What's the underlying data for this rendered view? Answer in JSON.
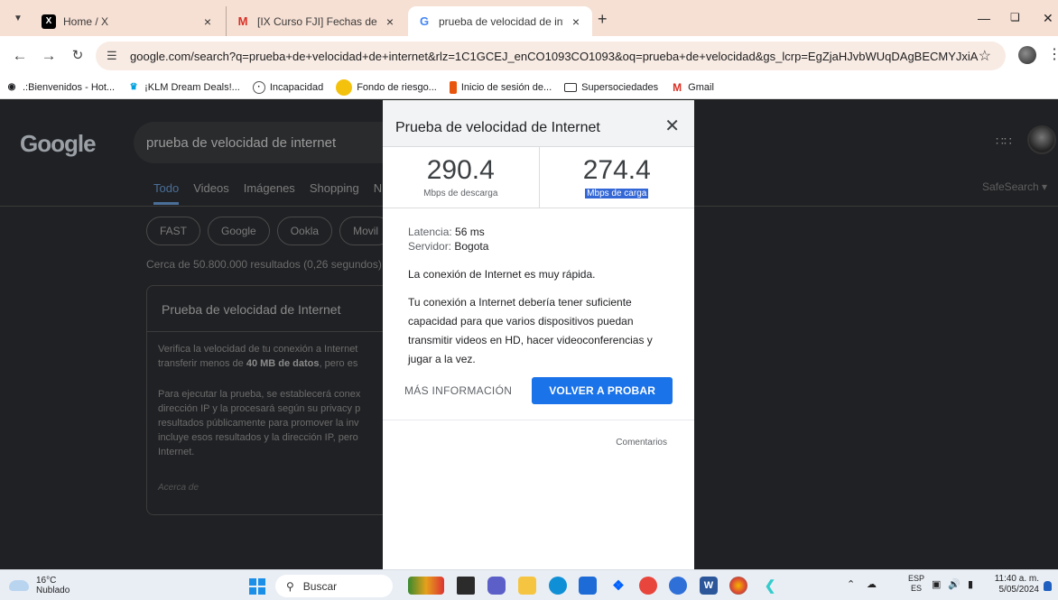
{
  "browser": {
    "tabs": [
      {
        "title": "Home / X",
        "favicon": "x-logo-icon"
      },
      {
        "title": "[IX Curso FJI] Fechas de los proc",
        "favicon": "gmail-icon"
      },
      {
        "title": "prueba de velocidad de interne",
        "favicon": "google-g-icon",
        "active": true
      }
    ],
    "url": "google.com/search?q=prueba+de+velocidad+de+internet&rlz=1C1GCEJ_enCO1093CO1093&oq=prueba+de+velocidad&gs_lcrp=EgZjaHJvbWUqDAgBECMYJxiABBiKBTIOCA...",
    "bookmarks": [
      ".:Bienvenidos - Hot...",
      "¡KLM Dream Deals!...",
      "Incapacidad",
      "Fondo de riesgo...",
      "Inicio de sesión de...",
      "Supersociedades",
      "Gmail"
    ]
  },
  "google": {
    "logo": "Google",
    "query": "prueba de velocidad de internet",
    "tabs": [
      "Todo",
      "Videos",
      "Imágenes",
      "Shopping",
      "N"
    ],
    "chips": [
      "FAST",
      "Google",
      "Ookla",
      "Movil"
    ],
    "result_count": "Cerca de 50.800.000 resultados (0,26 segundos)",
    "safesearch": "SafeSearch",
    "card": {
      "title": "Prueba de velocidad de Internet",
      "p1_a": "Verifica la velocidad de tu conexión a Internet",
      "p1_b_pre": "transferir menos de ",
      "p1_b_bold": "40 MB de datos",
      "p1_b_post": ", pero es",
      "p2_l1": "Para ejecutar la prueba, se establecerá conex",
      "p2_l2": "dirección IP y la procesará según su privacy p",
      "p2_l3": "resultados públicamente para promover la inv",
      "p2_l4": "incluye esos resultados y la dirección IP, pero",
      "p2_l5": "Internet.",
      "footer": "Acerca de"
    }
  },
  "speedtest": {
    "title": "Prueba de velocidad de Internet",
    "download": {
      "value": "290.4",
      "unit": "Mbps de descarga"
    },
    "upload": {
      "value": "274.4",
      "unit": "Mbps de carga"
    },
    "latency_label": "Latencia: ",
    "latency_value": "56 ms",
    "server_label": "Servidor: ",
    "server_value": "Bogota",
    "verdict": "La conexión de Internet es muy rápida.",
    "description": "Tu conexión a Internet debería tener suficiente capacidad para que varios dispositivos puedan transmitir videos en HD, hacer videoconferencias y jugar a la vez.",
    "more_info": "MÁS INFORMACIÓN",
    "retry": "VOLVER A PROBAR",
    "feedback": "Comentarios",
    "accent": "#1a73e8"
  },
  "taskbar": {
    "temperature": "16°C",
    "weather": "Nublado",
    "search": "Buscar",
    "lang_top": "ESP",
    "lang_bottom": "ES",
    "time": "11:40 a. m.",
    "date": "5/05/2024"
  }
}
